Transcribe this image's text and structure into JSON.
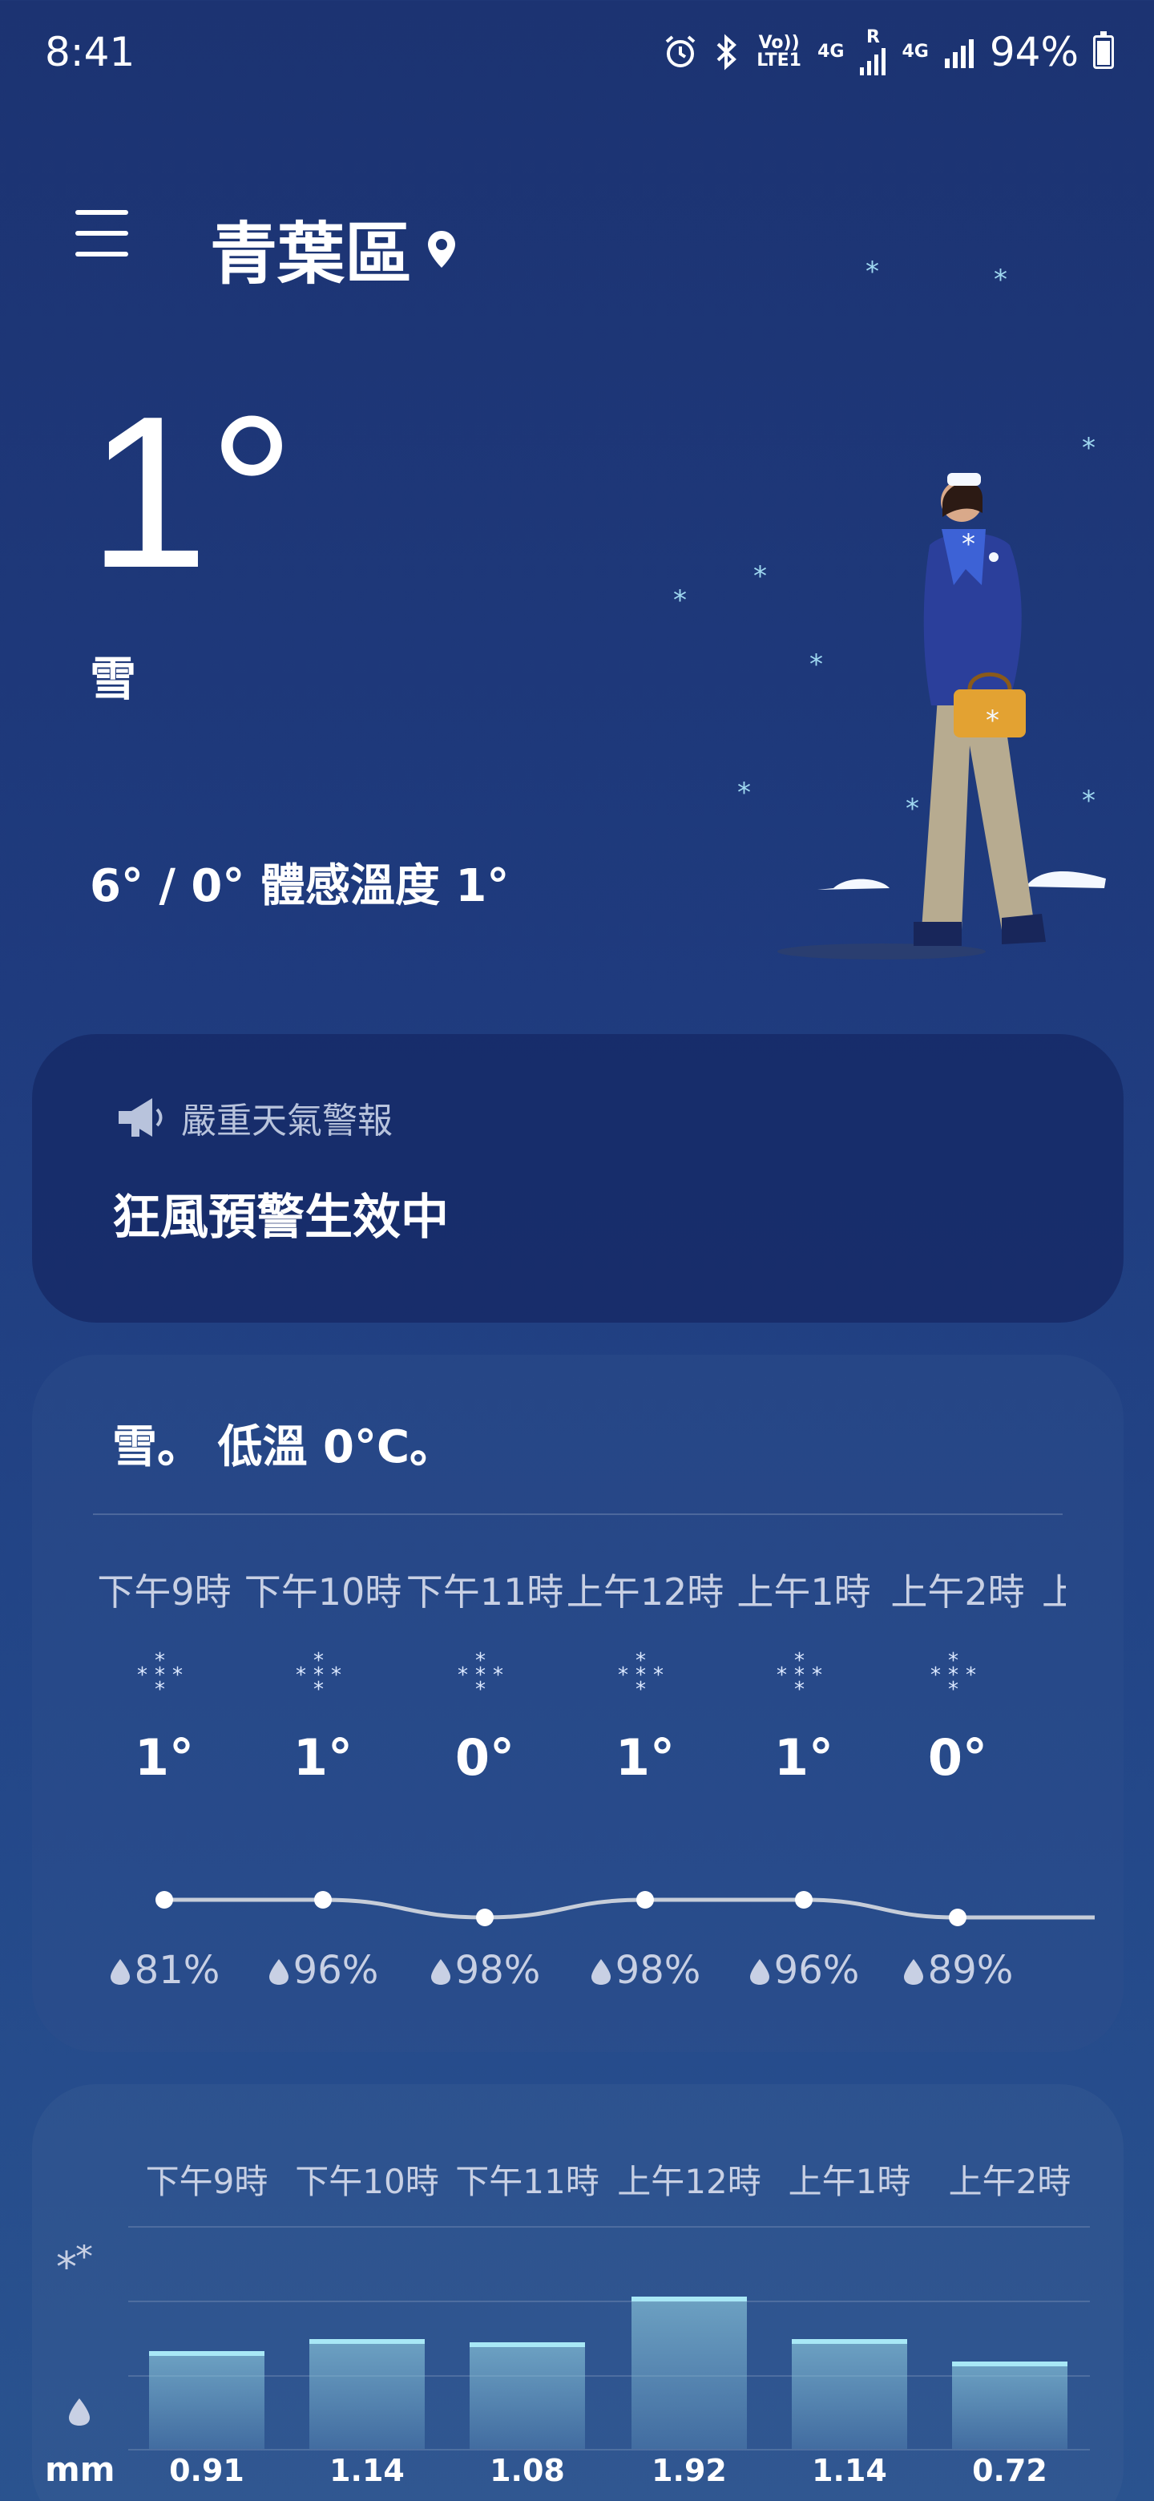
{
  "status_bar": {
    "time": "8:41",
    "volte": "Vo)) LTE1",
    "net1": "4G",
    "roaming": "R",
    "net2": "4G",
    "battery": "94%"
  },
  "header": {
    "location": "青葉區",
    "menu_icon": "hamburger-menu-icon",
    "pin_icon": "location-pin-icon"
  },
  "current": {
    "temperature": "1°",
    "condition": "雪",
    "high_low_feels": "6° / 0° 體感溫度 1°"
  },
  "alert": {
    "icon": "megaphone-icon",
    "title": "嚴重天氣警報",
    "message": "狂風預警生效中"
  },
  "hourly": {
    "summary": "雪。 低溫 0°C。",
    "hours": [
      {
        "label": "下午9時",
        "temp": "1°",
        "temp_value": 1,
        "humidity": "81%",
        "icon": "snow-icon"
      },
      {
        "label": "下午10時",
        "temp": "1°",
        "temp_value": 1,
        "humidity": "96%",
        "icon": "snow-icon"
      },
      {
        "label": "下午11時",
        "temp": "0°",
        "temp_value": 0,
        "humidity": "98%",
        "icon": "snow-icon"
      },
      {
        "label": "上午12時",
        "temp": "1°",
        "temp_value": 1,
        "humidity": "98%",
        "icon": "snow-icon"
      },
      {
        "label": "上午1時",
        "temp": "1°",
        "temp_value": 1,
        "humidity": "96%",
        "icon": "snow-icon"
      },
      {
        "label": "上午2時",
        "temp": "0°",
        "temp_value": 0,
        "humidity": "89%",
        "icon": "snow-icon"
      }
    ],
    "partial_next": "上"
  },
  "precipitation": {
    "unit": "mm",
    "type_icon": "snowflakes-icon",
    "drop_icon": "raindrop-icon",
    "hours": [
      {
        "label": "下午9時",
        "value": "0.91",
        "amount": 0.91
      },
      {
        "label": "下午10時",
        "value": "1.14",
        "amount": 1.14
      },
      {
        "label": "下午11時",
        "value": "1.08",
        "amount": 1.08
      },
      {
        "label": "上午12時",
        "value": "1.92",
        "amount": 1.92
      },
      {
        "label": "上午1時",
        "value": "1.14",
        "amount": 1.14
      },
      {
        "label": "上午2時",
        "value": "0.72",
        "amount": 0.72
      }
    ]
  },
  "colors": {
    "background_top": "#1c3372",
    "background_bottom": "#2a538f",
    "bar_accent": "#a8e8f6"
  }
}
